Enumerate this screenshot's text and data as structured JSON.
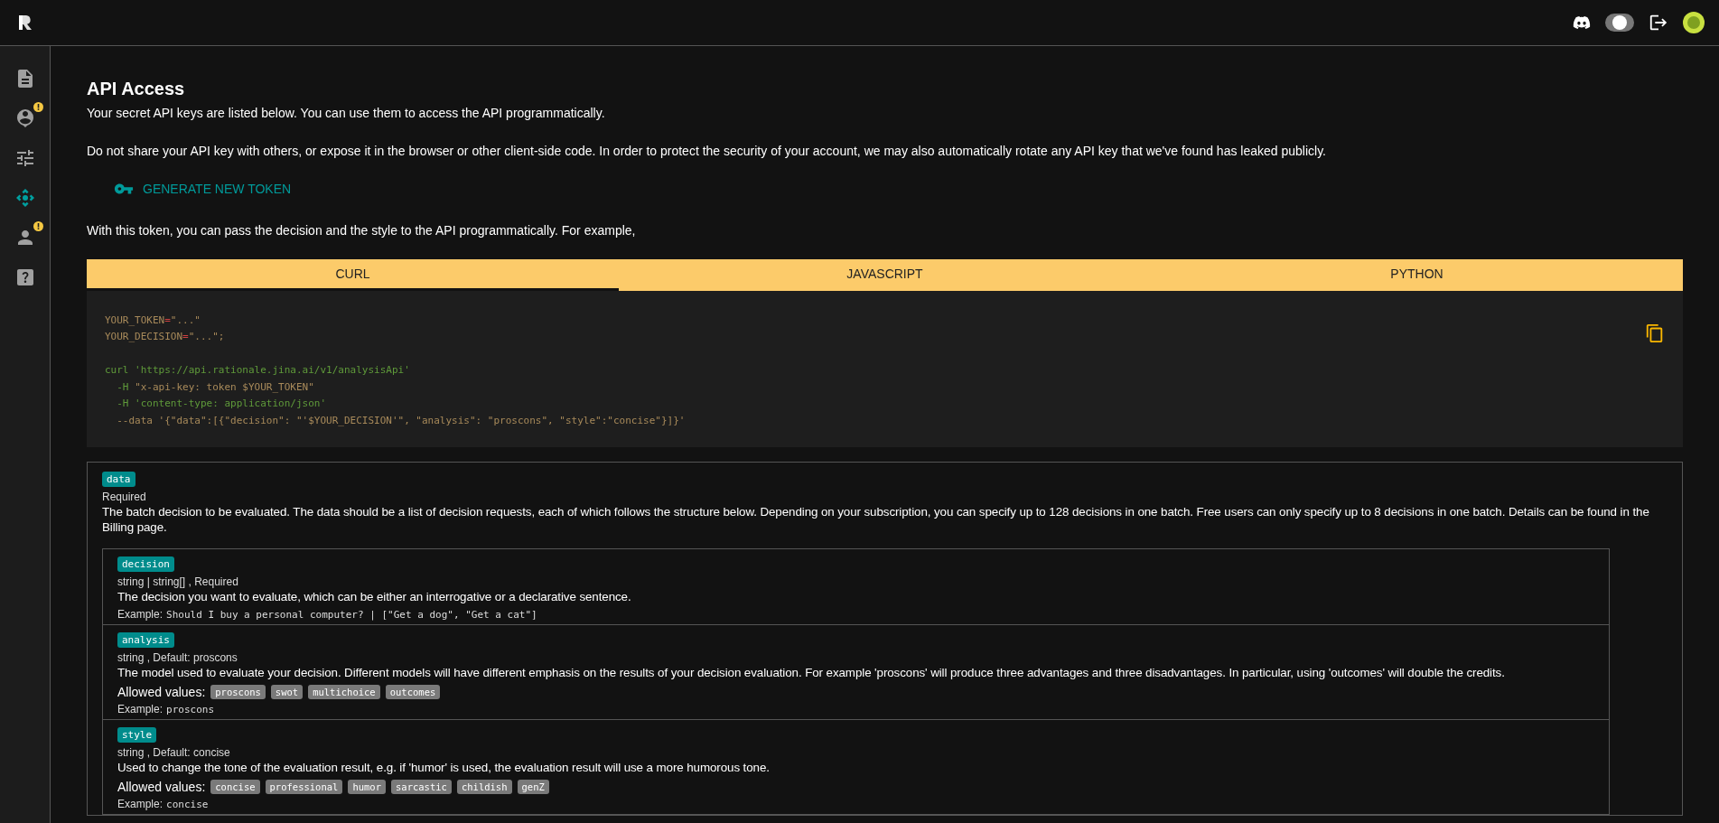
{
  "sidebar": {
    "items": [
      {
        "selected": false,
        "badge": false
      },
      {
        "selected": false,
        "badge": true
      },
      {
        "selected": false,
        "badge": false
      },
      {
        "selected": true,
        "badge": false
      },
      {
        "selected": false,
        "badge": true
      },
      {
        "selected": false,
        "badge": false
      }
    ]
  },
  "header": {
    "theme_toggle": {
      "on": false
    }
  },
  "title": "API Access",
  "intro": "Your secret API keys are listed below. You can use them to access the API programmatically.",
  "warning": "Do not share your API key with others, or expose it in the browser or other client-side code. In order to protect the security of your account, we may also automatically rotate any API key that we've found has leaked publicly.",
  "generate_button": "GENERATE NEW TOKEN",
  "example_intro": "With this token, you can pass the decision and the style to the API programmatically. For example,",
  "tabs": [
    {
      "label": "CURL",
      "selected": true
    },
    {
      "label": "JAVASCRIPT",
      "selected": false
    },
    {
      "label": "PYTHON",
      "selected": false
    }
  ],
  "code": {
    "lines": [
      {
        "tokens": [
          {
            "kind": "var",
            "text": "YOUR_TOKEN"
          },
          {
            "kind": "op",
            "text": "="
          },
          {
            "kind": "str",
            "text": "\"...\""
          }
        ]
      },
      {
        "tokens": [
          {
            "kind": "var",
            "text": "YOUR_DECISION"
          },
          {
            "kind": "op",
            "text": "="
          },
          {
            "kind": "str",
            "text": "\"...\";"
          }
        ]
      },
      {
        "gap_before": true,
        "tokens": [
          {
            "kind": "cmd",
            "text": "curl 'https://api.rationale.jina.ai/v1/analysisApi'"
          }
        ]
      },
      {
        "tokens": [
          {
            "kind": "cmd",
            "text": "  -H "
          },
          {
            "kind": "str",
            "text": "\"x-api-key: token $YOUR_TOKEN\""
          }
        ]
      },
      {
        "tokens": [
          {
            "kind": "cmd",
            "text": "  -H 'content-type: application/json'"
          }
        ]
      },
      {
        "tokens": [
          {
            "kind": "str",
            "text": "  --data '{\"data\":[{\"decision\": \"'$YOUR_DECISION'\", \"analysis\": \"proscons\", \"style\":\"concise\"}]}'"
          }
        ]
      }
    ]
  },
  "params": {
    "name": "data",
    "meta": "Required",
    "description": "The batch decision to be evaluated. The data should be a list of decision requests, each of which follows the structure below. Depending on your subscription, you can specify up to 128 decisions in one batch. Free users can only specify up to 8 decisions in one batch. Details can be found in the Billing page.",
    "fields": [
      {
        "name": "decision",
        "meta": "string | string[] , Required",
        "description": "The decision you want to evaluate, which can be either an interrogative or a declarative sentence.",
        "example_label": "Example:",
        "example": "Should I buy a personal computer? | [\"Get a dog\", \"Get a cat\"]"
      },
      {
        "name": "analysis",
        "meta": "string , Default: proscons",
        "description": "The model used to evaluate your decision. Different models will have different emphasis on the results of your decision evaluation. For example 'proscons' will produce three advantages and three disadvantages. In particular, using 'outcomes' will double the credits.",
        "allowed_label": "Allowed values:",
        "allowed": [
          "proscons",
          "swot",
          "multichoice",
          "outcomes"
        ],
        "example_label": "Example:",
        "example": "proscons"
      },
      {
        "name": "style",
        "meta": "string , Default: concise",
        "description": "Used to change the tone of the evaluation result, e.g. if 'humor' is used, the evaluation result will use a more humorous tone.",
        "allowed_label": "Allowed values:",
        "allowed": [
          "concise",
          "professional",
          "humor",
          "sarcastic",
          "childish",
          "genZ"
        ],
        "example_label": "Example:",
        "example": "concise"
      }
    ]
  }
}
